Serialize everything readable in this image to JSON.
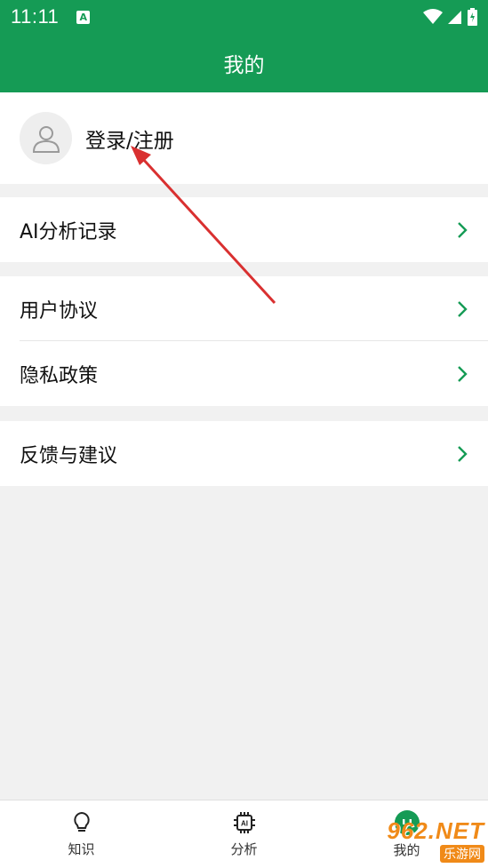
{
  "status_bar": {
    "time": "11:11",
    "notification_icon": "A"
  },
  "header": {
    "title": "我的"
  },
  "profile": {
    "login_label": "登录/注册"
  },
  "menu": {
    "ai_records": "AI分析记录",
    "user_agreement": "用户协议",
    "privacy_policy": "隐私政策",
    "feedback": "反馈与建议"
  },
  "bottom_nav": {
    "tabs": [
      {
        "label": "知识",
        "icon": "lightbulb-icon"
      },
      {
        "label": "分析",
        "icon": "ai-chip-icon"
      },
      {
        "label": "我的",
        "icon": "profile-face-icon",
        "active": true
      }
    ]
  },
  "watermark": {
    "top": "962.NET",
    "bottom": "乐游网"
  },
  "colors": {
    "primary": "#159b55",
    "chevron": "#159b55",
    "background": "#f1f1f1",
    "annotation_arrow": "#d93030"
  }
}
